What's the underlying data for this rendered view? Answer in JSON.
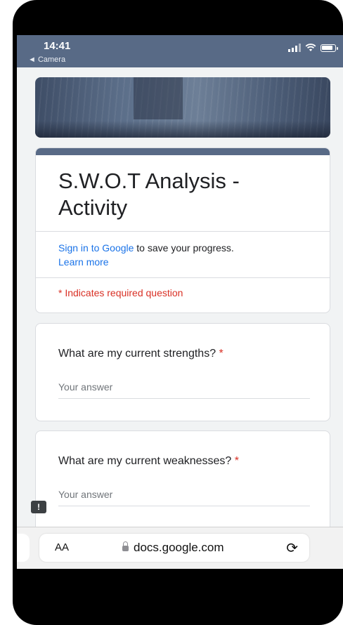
{
  "status_bar": {
    "time": "14:41",
    "back_label": "◄ Camera"
  },
  "form": {
    "title": "S.W.O.T Analysis - Activity",
    "signin_link": "Sign in to Google",
    "signin_rest": " to save your progress.",
    "learn_more": "Learn more",
    "required_note": "* Indicates required question",
    "questions": [
      {
        "label": "What are my current strengths?",
        "required_mark": "*",
        "placeholder": "Your answer"
      },
      {
        "label": "What are my current weaknesses?",
        "required_mark": "*",
        "placeholder": "Your answer"
      }
    ]
  },
  "browser": {
    "text_size_label": "AA",
    "domain": "docs.google.com",
    "reload_icon": "⟳"
  },
  "feedback_icon": "!",
  "colors": {
    "theme": "#586a86",
    "link": "#1a73e8",
    "required": "#d93025"
  }
}
